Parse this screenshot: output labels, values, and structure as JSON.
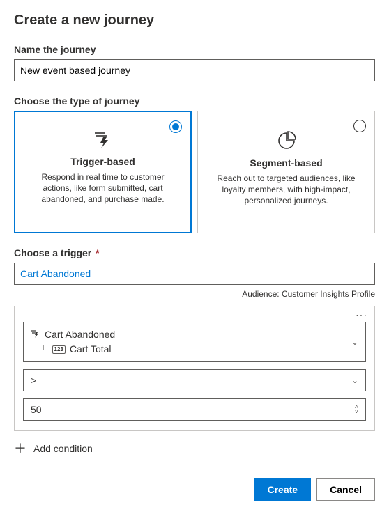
{
  "header": {
    "title": "Create a new journey"
  },
  "name_section": {
    "label": "Name the journey",
    "value": "New event based journey"
  },
  "type_section": {
    "label": "Choose the type of journey",
    "cards": [
      {
        "title": "Trigger-based",
        "desc": "Respond in real time to customer actions, like form submitted, cart abandoned, and purchase made.",
        "selected": true
      },
      {
        "title": "Segment-based",
        "desc": "Reach out to targeted audiences, like loyalty members, with high-impact, personalized journeys.",
        "selected": false
      }
    ]
  },
  "trigger_section": {
    "label": "Choose a trigger",
    "required_marker": "*",
    "value": "Cart Abandoned",
    "audience_label": "Audience: Customer Insights Profile"
  },
  "condition_panel": {
    "attribute_root": "Cart Abandoned",
    "attribute_child": "Cart Total",
    "operator": ">",
    "value": "50"
  },
  "add_condition_label": "Add condition",
  "footer": {
    "create": "Create",
    "cancel": "Cancel"
  }
}
